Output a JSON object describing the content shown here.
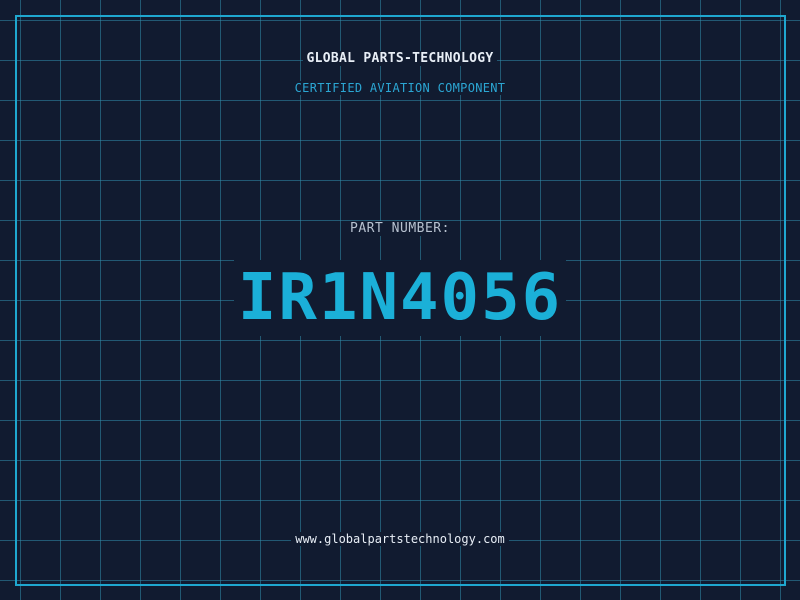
{
  "header": {
    "company": "GLOBAL PARTS-TECHNOLOGY",
    "subtitle": "CERTIFIED AVIATION COMPONENT"
  },
  "part": {
    "label": "PART NUMBER:",
    "number": "IR1N4056"
  },
  "footer": {
    "website": "www.globalpartstechnology.com"
  },
  "colors": {
    "background": "#111b30",
    "grid": "#308caa",
    "frame": "#1fa7cf",
    "accent": "#1bb0d8",
    "title_text": "#e8eef6",
    "label_text": "#b7c1cf"
  }
}
